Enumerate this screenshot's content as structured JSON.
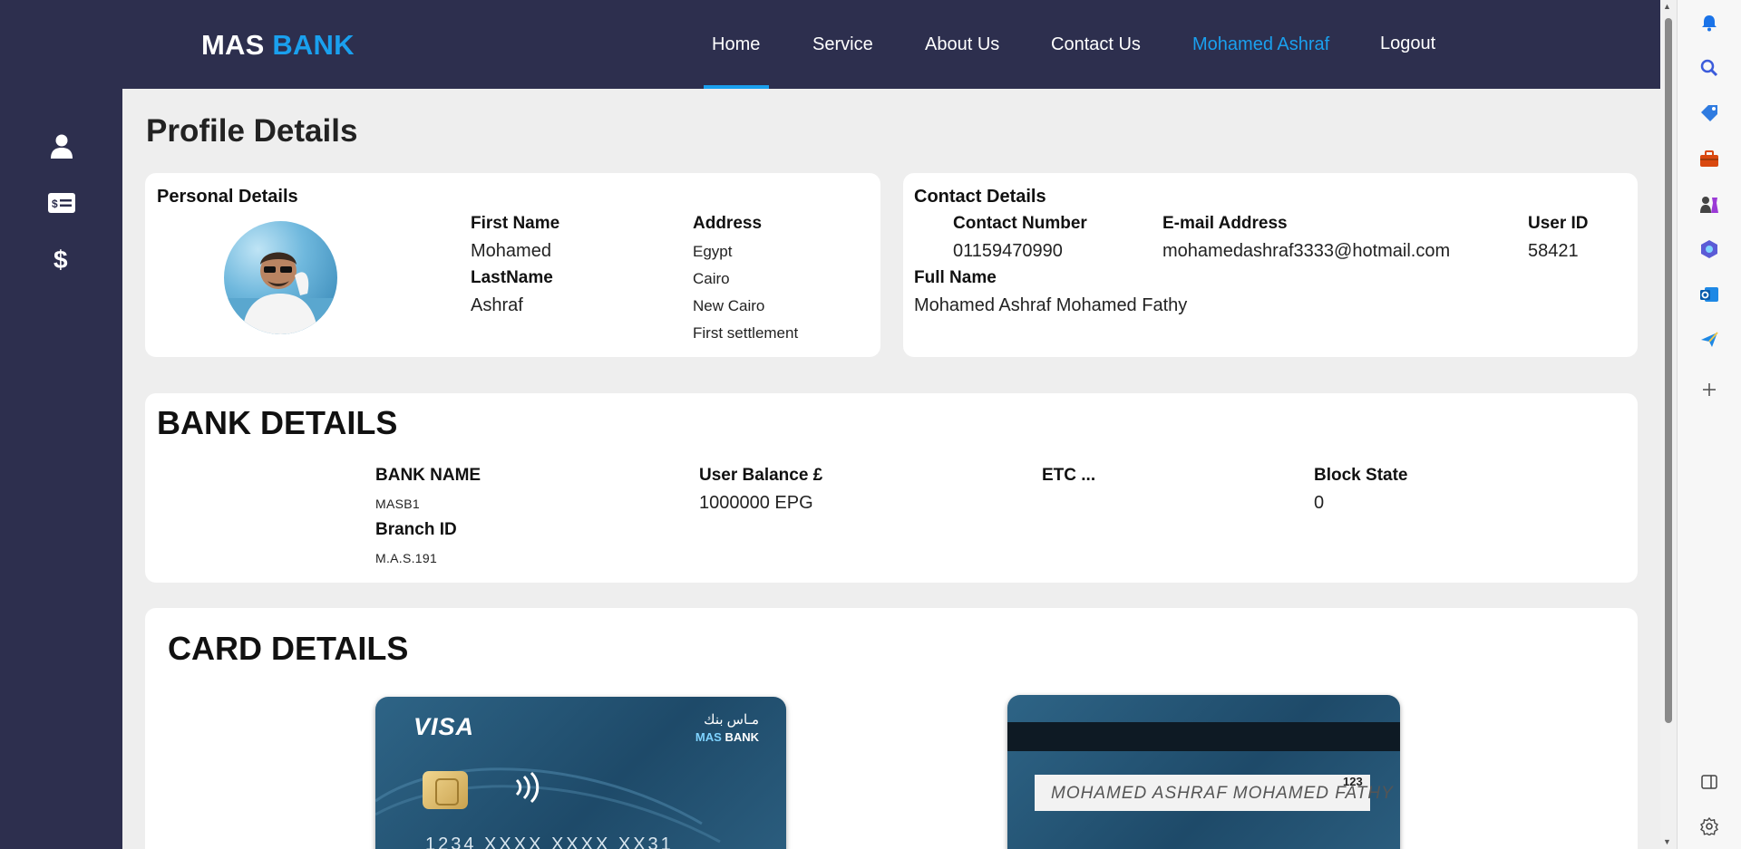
{
  "brand": {
    "prefix": "MAS",
    "accent": "BANK"
  },
  "nav": {
    "home": "Home",
    "service": "Service",
    "about": "About Us",
    "contact": "Contact Us",
    "user": "Mohamed Ashraf",
    "logout": "Logout"
  },
  "sidebar": {
    "icons": [
      "user-icon",
      "id-card-icon",
      "dollar-icon"
    ]
  },
  "page_title": "Profile Details",
  "personal": {
    "title": "Personal Details",
    "first_name_label": "First Name",
    "first_name": "Mohamed",
    "last_name_label": "LastName",
    "last_name": "Ashraf",
    "address_label": "Address",
    "address_lines": [
      "Egypt",
      "Cairo",
      "New Cairo",
      "First settlement"
    ]
  },
  "contact": {
    "title": "Contact Details",
    "phone_label": "Contact Number",
    "phone": "01159470990",
    "email_label": "E-mail Address",
    "email": "mohamedashraf3333@hotmail.com",
    "userid_label": "User ID",
    "userid": "58421",
    "fullname_label": "Full Name",
    "fullname": "Mohamed Ashraf Mohamed Fathy"
  },
  "bank": {
    "title": "BANK DETAILS",
    "bank_name_label": "BANK NAME",
    "bank_name": "MASB1",
    "branch_label": "Branch ID",
    "branch": "M.A.S.191",
    "balance_label": "User Balance £",
    "balance": "1000000 EPG",
    "etc_label": "ETC ...",
    "block_label": "Block State",
    "block": "0"
  },
  "cards": {
    "title": "CARD DETAILS",
    "front": {
      "network": "VISA",
      "bank_ar": "مـاس بنك",
      "bank_en_prefix": "MAS",
      "bank_en_accent": "BANK",
      "number": "1234  XXXX  XXXX  XX31"
    },
    "back": {
      "signature": "MOHAMED ASHRAF MOHAMED FATHY",
      "cvv": "123"
    }
  },
  "colors": {
    "nav_bg": "#2d2f4e",
    "accent": "#1aa0ee",
    "page_bg": "#eeeeee"
  }
}
